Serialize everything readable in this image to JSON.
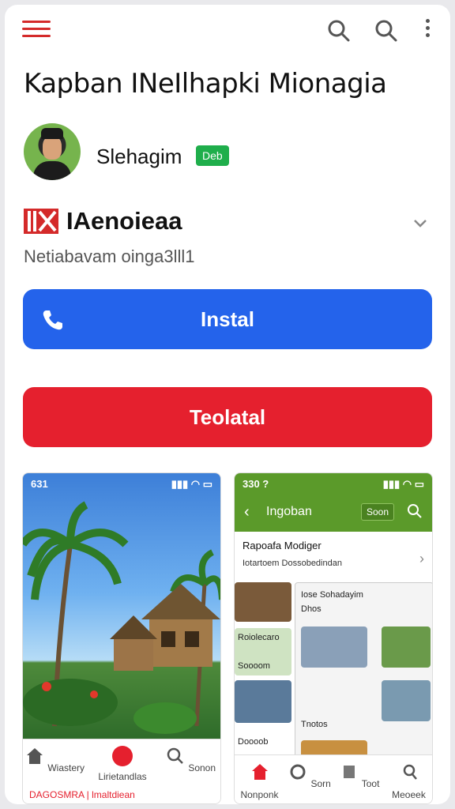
{
  "app_title": "Kapban INeIlhapki Mionagia",
  "developer": {
    "name": "Slehagim",
    "badge": "Deb"
  },
  "app_name": "IAenoieaa",
  "subtitle": "Netiabavam oinga3lll1",
  "buttons": {
    "install": "Instal",
    "secondary": "Teolatal"
  },
  "icons": {
    "menu": "hamburger-menu-icon",
    "search": "search-icon",
    "more": "more-vertical-icon",
    "phone": "phone-icon",
    "chevron": "chevron-down-icon"
  },
  "colors": {
    "primary": "#2463eb",
    "danger": "#e5202e",
    "badge": "#1fae4b",
    "accent": "#d42a2a"
  },
  "screenshot1": {
    "status_time": "631",
    "nav": [
      "Wiastery",
      "Lirietandlas",
      "Sonon"
    ],
    "footer": "DAGOSMRA | lmaltdiean"
  },
  "screenshot2": {
    "status_time": "330 ?",
    "header_title": "Ingoban",
    "header_badge": "Soon",
    "row_title": "Rapoafa Modiger",
    "row_sub": "Iotartoem Dossobedindan",
    "card1_title": "Iose Sohadayim",
    "card1_sub": "Dhos",
    "left_title": "Roiolecaro",
    "left_sub": "Soooom",
    "bottom_left": "Doooob",
    "bottom_mid": "Tnotos",
    "nav": [
      "Nonponk",
      "Sorn",
      "Toot",
      "Meoeek"
    ]
  }
}
